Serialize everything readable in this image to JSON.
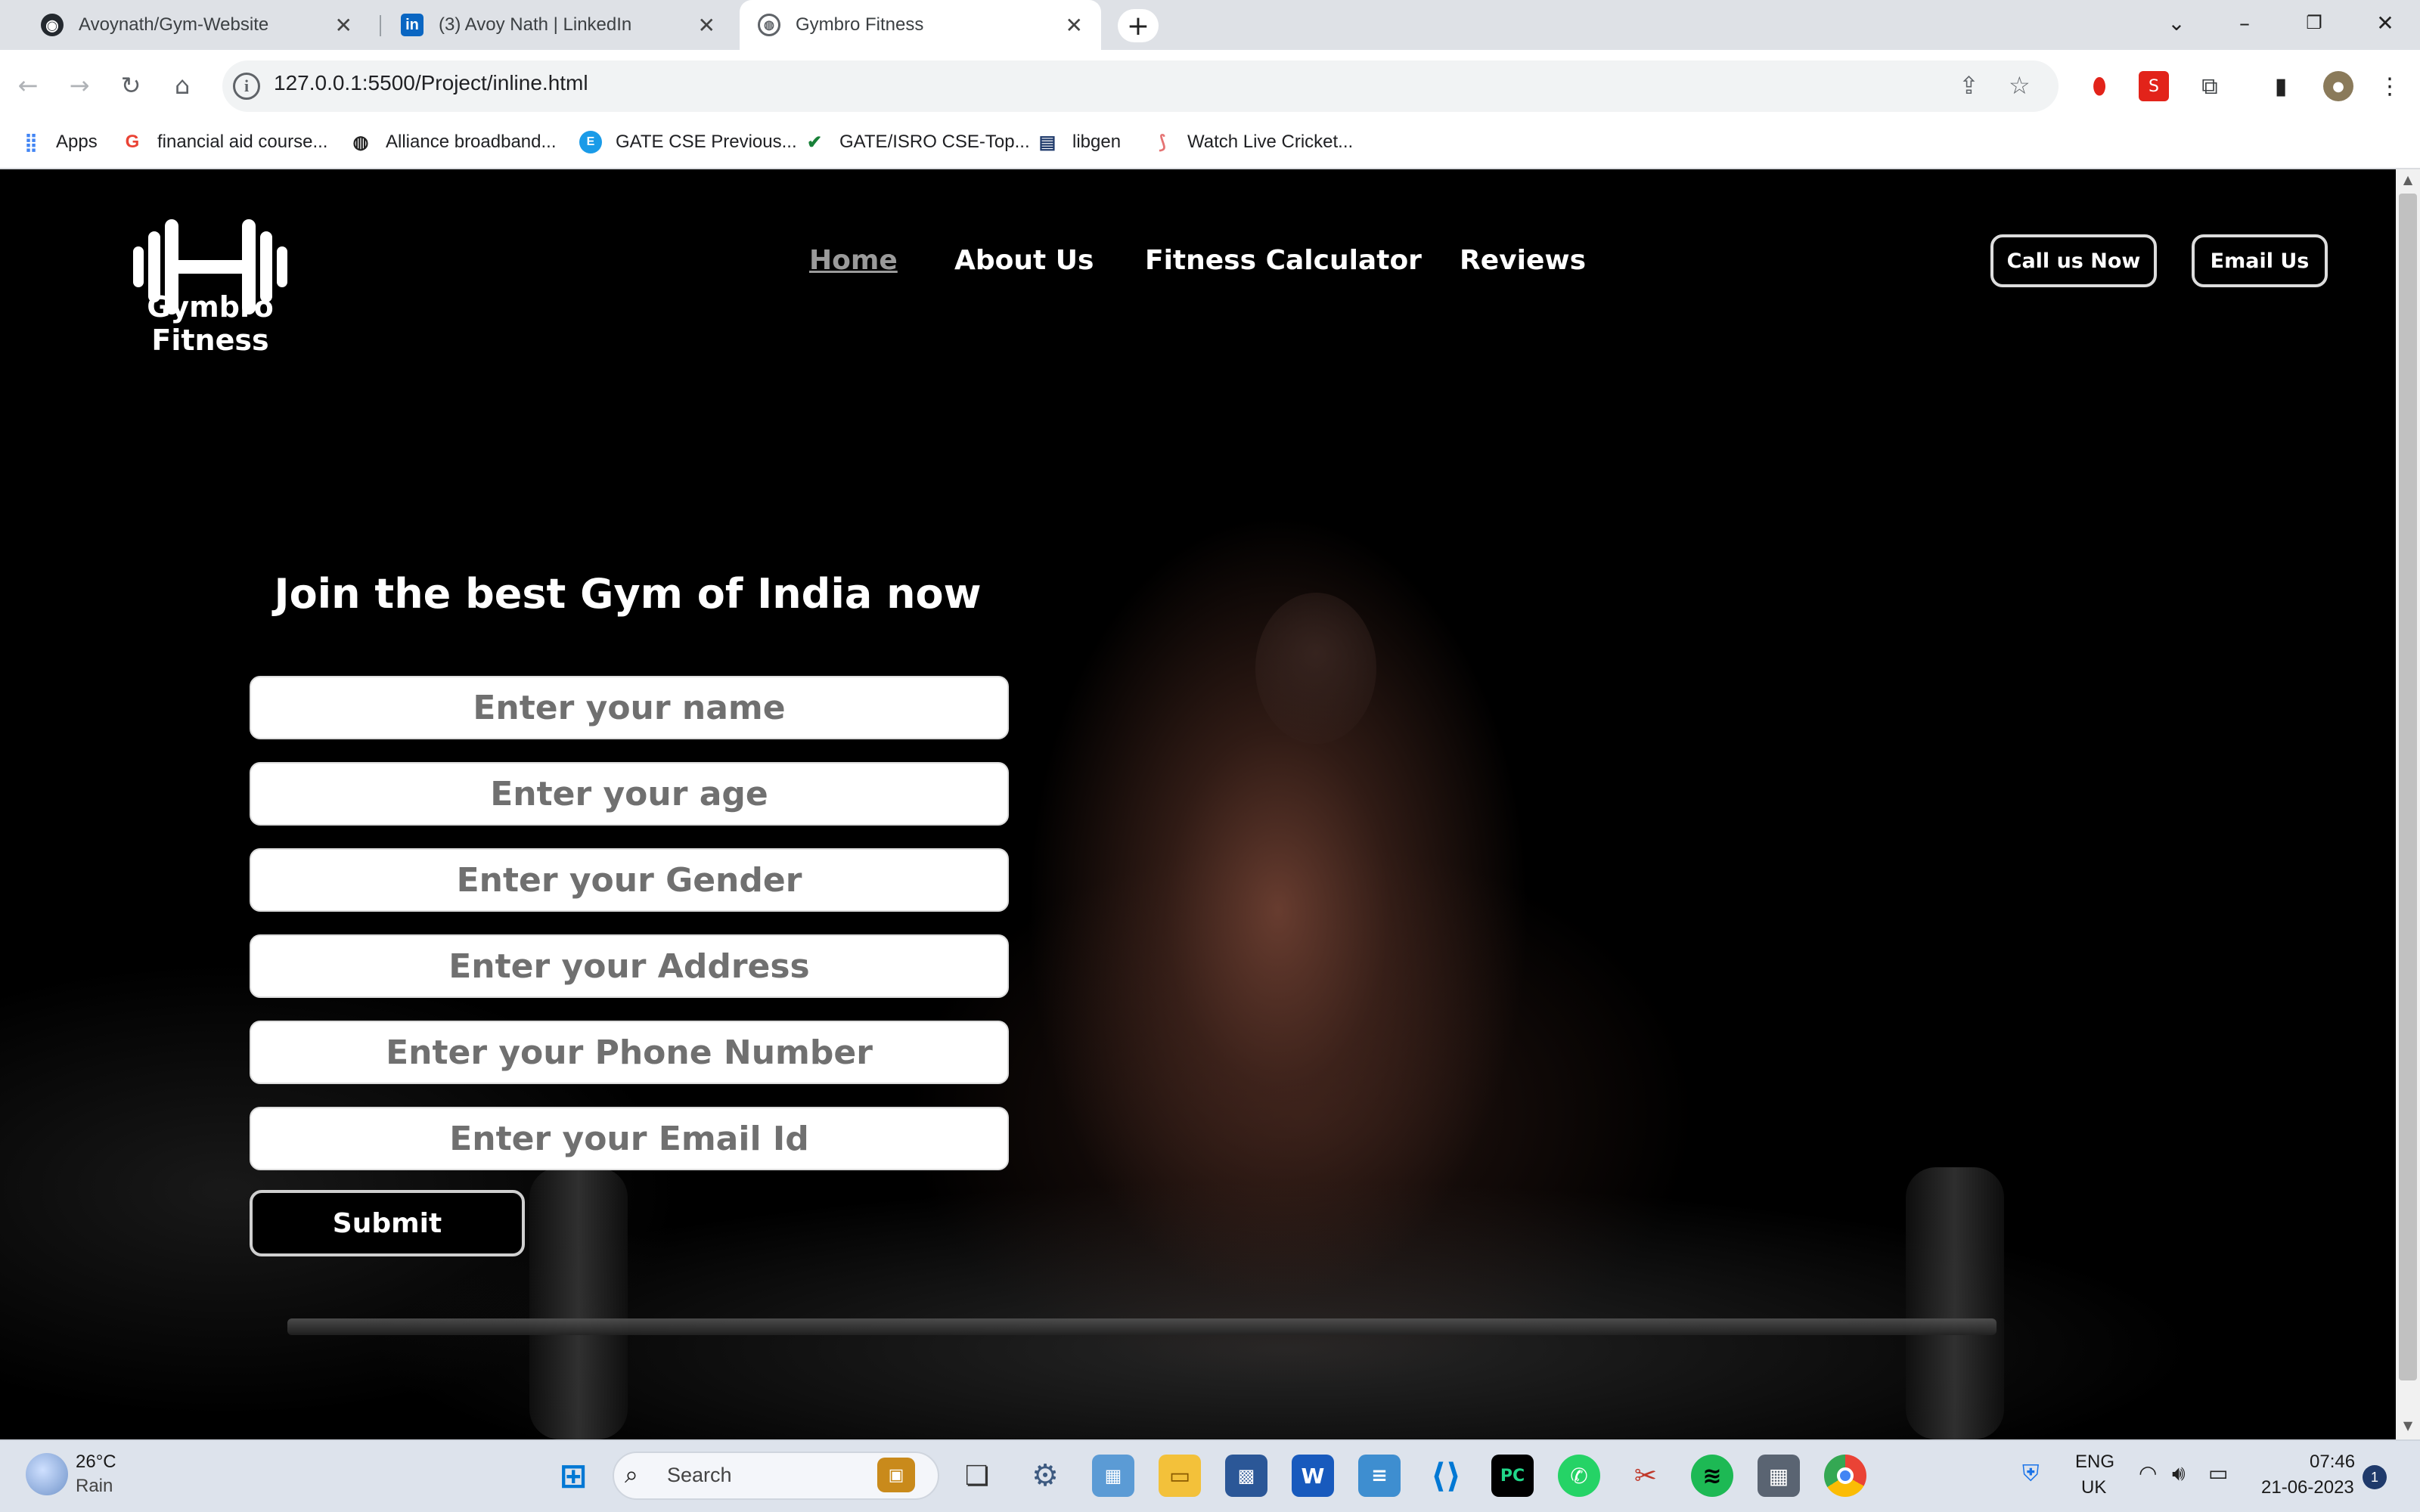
{
  "browser": {
    "tabs": [
      {
        "title": "Avoynath/Gym-Website",
        "icon": "github-icon"
      },
      {
        "title": "(3) Avoy Nath | LinkedIn",
        "icon": "linkedin-icon"
      },
      {
        "title": "Gymbro Fitness",
        "icon": "globe-icon"
      }
    ],
    "url": "127.0.0.1:5500/Project/inline.html",
    "bookmarks": [
      {
        "label": "Apps",
        "icon": "apps-grid-icon"
      },
      {
        "label": "financial aid course...",
        "icon": "google-icon"
      },
      {
        "label": "Alliance broadband...",
        "icon": "globe-icon"
      },
      {
        "label": "GATE CSE Previous...",
        "icon": "edu-icon"
      },
      {
        "label": "GATE/ISRO CSE-Top...",
        "icon": "check-icon"
      },
      {
        "label": "libgen",
        "icon": "book-icon"
      },
      {
        "label": "Watch Live Cricket...",
        "icon": "cricket-icon"
      }
    ]
  },
  "site": {
    "brand": "Gymbro Fitness",
    "nav": [
      "Home",
      "About Us",
      "Fitness Calculator",
      "Reviews"
    ],
    "active_nav": "Home",
    "call_button": "Call us Now",
    "email_button": "Email Us"
  },
  "form": {
    "title": "Join the best Gym of India now",
    "fields": [
      "Enter your name",
      "Enter your age",
      "Enter your Gender",
      "Enter your Address",
      "Enter your Phone Number",
      "Enter your Email Id"
    ],
    "submit": "Submit"
  },
  "taskbar": {
    "weather_temp": "26°C",
    "weather_desc": "Rain",
    "search": "Search",
    "lang_top": "ENG",
    "lang_bottom": "UK",
    "time": "07:46",
    "date": "21-06-2023",
    "notifications": "1"
  },
  "colors": {
    "page_bg": "#000000",
    "nav_active": "#9a9a9a",
    "field_text": "#707070",
    "chrome_bg": "#dee1e6"
  }
}
